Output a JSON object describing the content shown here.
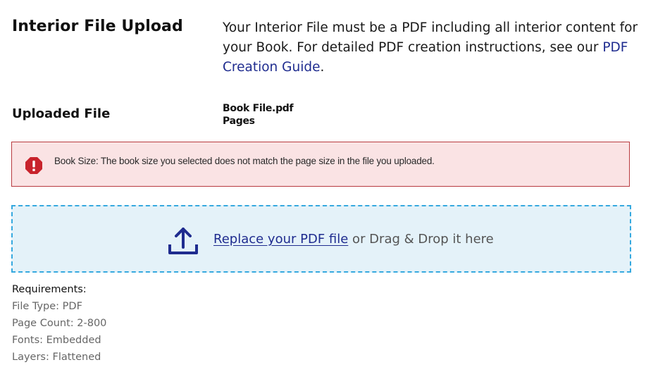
{
  "interior": {
    "title": "Interior File Upload",
    "description_text": "Your Interior File must be a PDF including all interior content for your Book. For detailed PDF creation instructions, see our",
    "guide_link": "PDF Creation Guide",
    "guide_suffix": "."
  },
  "uploaded": {
    "title": "Uploaded File",
    "file_name": "Book File.pdf",
    "pages_label": "Pages"
  },
  "error": {
    "icon": "exclamation-octagon-icon",
    "message": "Book Size: The book size you selected does not match the page size in the file you uploaded.",
    "color": "#c8232c"
  },
  "dropzone": {
    "icon": "upload-icon",
    "link_text": "Replace your PDF file",
    "suffix_text": " or Drag & Drop it here"
  },
  "requirements": {
    "heading": "Requirements:",
    "items": [
      "File Type: PDF",
      "Page Count: 2-800",
      "Fonts: Embedded",
      "Layers: Flattened"
    ]
  }
}
